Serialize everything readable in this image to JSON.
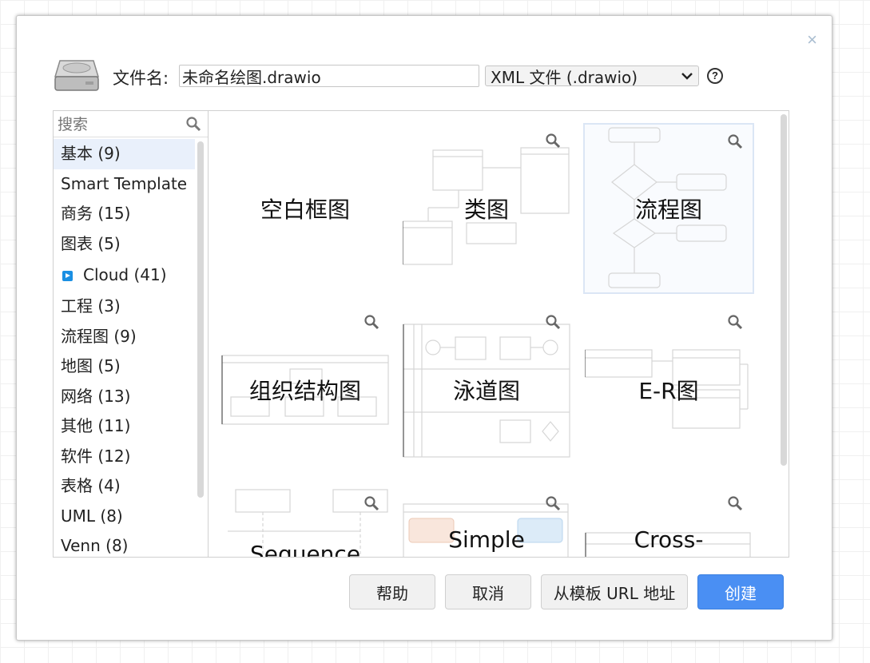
{
  "dialog": {
    "filename_label": "文件名:",
    "filename_value": "未命名绘图.drawio",
    "format_selected": "XML 文件 (.drawio)",
    "help_symbol": "?",
    "close_symbol": "×"
  },
  "search": {
    "placeholder": "搜索"
  },
  "categories": [
    {
      "label": "基本 (9)"
    },
    {
      "label": "Smart Template"
    },
    {
      "label": "商务 (15)"
    },
    {
      "label": "图表 (5)"
    },
    {
      "label": "Cloud (41)"
    },
    {
      "label": "工程 (3)"
    },
    {
      "label": "流程图 (9)"
    },
    {
      "label": "地图 (5)"
    },
    {
      "label": "网络 (13)"
    },
    {
      "label": "其他 (11)"
    },
    {
      "label": "软件 (12)"
    },
    {
      "label": "表格 (4)"
    },
    {
      "label": "UML (8)"
    },
    {
      "label": "Venn (8)"
    }
  ],
  "templates": [
    {
      "label": "空白框图"
    },
    {
      "label": "类图"
    },
    {
      "label": "流程图"
    },
    {
      "label": "组织结构图"
    },
    {
      "label": "泳道图"
    },
    {
      "label": "E-R图"
    },
    {
      "label": "Sequence"
    },
    {
      "label": "Simple"
    },
    {
      "label": "Cross-"
    }
  ],
  "buttons": {
    "help": "帮助",
    "cancel": "取消",
    "from_url": "从模板 URL 地址",
    "create": "创建"
  },
  "colors": {
    "primary": "#4a8ff3",
    "selection": "#e9f0fb",
    "cloud_icon": "#1a8fe3"
  }
}
